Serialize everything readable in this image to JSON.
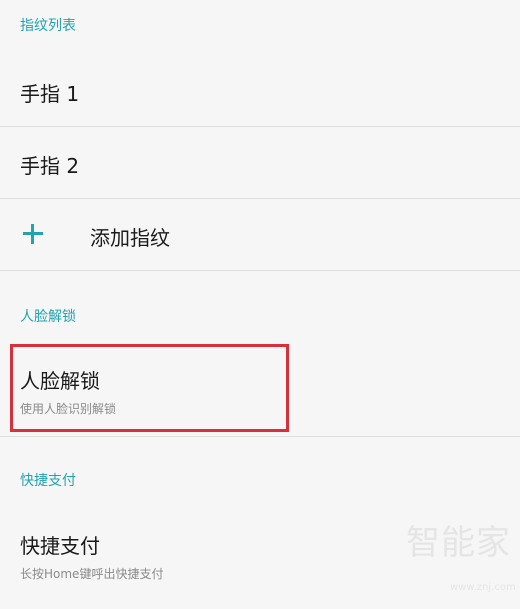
{
  "sections": {
    "fingerprint_header": "指纹列表",
    "face_header": "人脸解锁",
    "quickpay_header": "快捷支付"
  },
  "fingerprints": [
    {
      "label": "手指 1"
    },
    {
      "label": "手指 2"
    }
  ],
  "add_fingerprint": {
    "icon": "plus-icon",
    "label": "添加指纹"
  },
  "face_unlock": {
    "title": "人脸解锁",
    "subtitle": "使用人脸识别解锁"
  },
  "quick_pay": {
    "title": "快捷支付",
    "subtitle": "长按Home键呼出快捷支付"
  },
  "watermark": {
    "text": "智能家",
    "url": "www.znj.com"
  },
  "colors": {
    "accent": "#22a3b0",
    "highlight": "#d7303a",
    "background": "#f6f6f6"
  }
}
